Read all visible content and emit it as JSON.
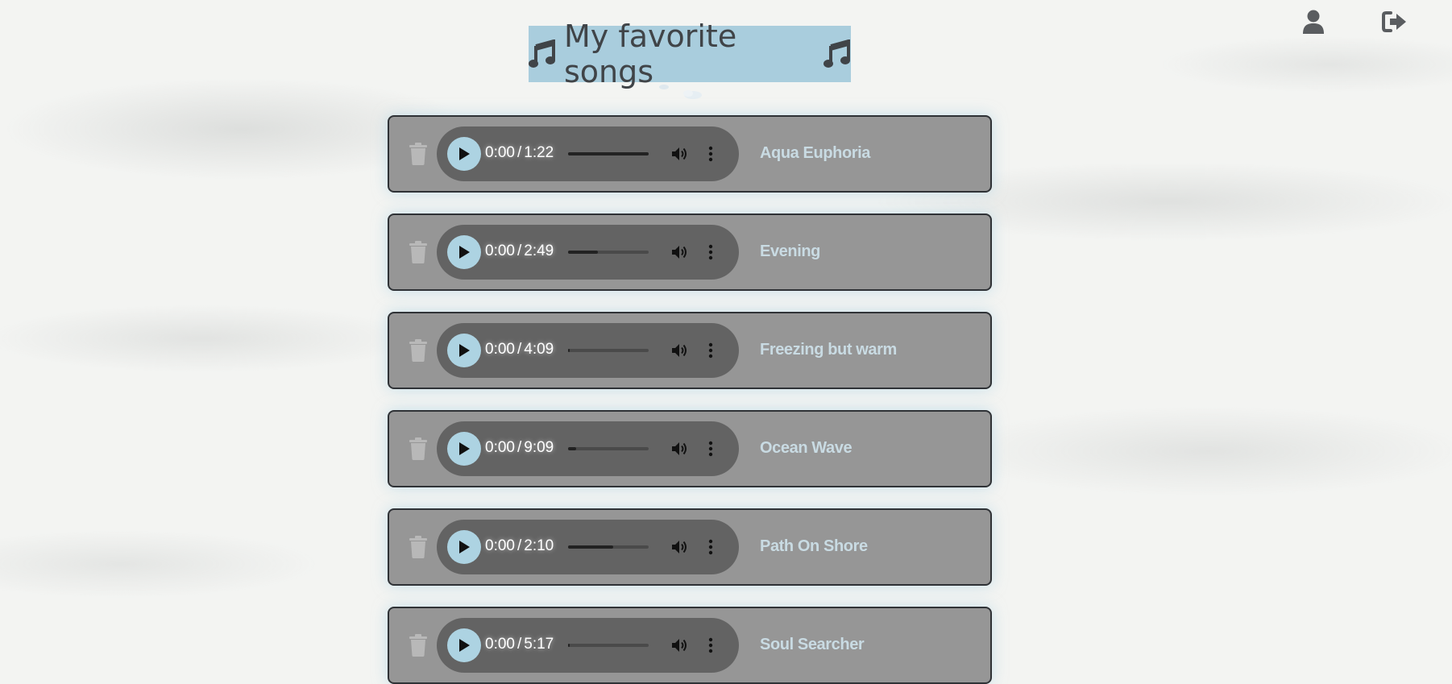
{
  "header": {
    "title": "My favorite songs",
    "user_icon": "user-icon",
    "logout_icon": "logout-icon"
  },
  "colors": {
    "title_bg": "#a9cddd",
    "card_bg": "#969696",
    "player_bg": "#636363",
    "play_button": "#add3e2",
    "song_title": "#c9dbe3"
  },
  "songs": [
    {
      "title": "Aqua Euphoria",
      "current": "0:00",
      "sep": "/",
      "duration": "1:22",
      "buffered": 1.0
    },
    {
      "title": "Evening",
      "current": "0:00",
      "sep": "/",
      "duration": "2:49",
      "buffered": 0.37
    },
    {
      "title": "Freezing but warm",
      "current": "0:00",
      "sep": "/",
      "duration": "4:09",
      "buffered": 0.02
    },
    {
      "title": "Ocean Wave",
      "current": "0:00",
      "sep": "/",
      "duration": "9:09",
      "buffered": 0.1
    },
    {
      "title": "Path On Shore",
      "current": "0:00",
      "sep": "/",
      "duration": "2:10",
      "buffered": 0.56
    },
    {
      "title": "Soul Searcher",
      "current": "0:00",
      "sep": "/",
      "duration": "5:17",
      "buffered": 0.02
    }
  ]
}
